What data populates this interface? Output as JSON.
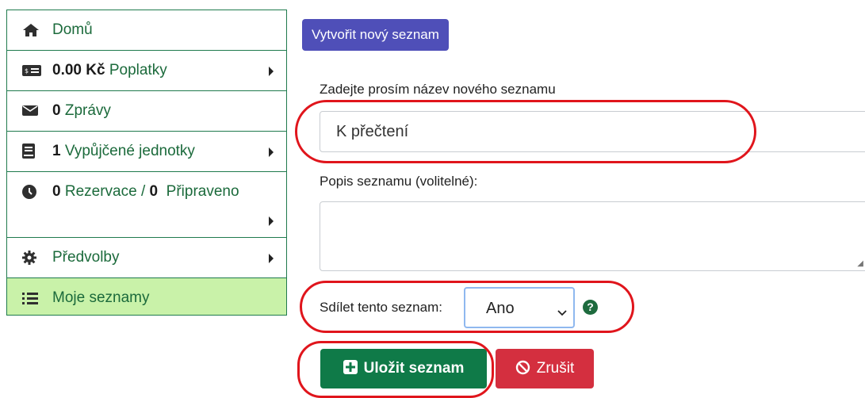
{
  "sidebar": {
    "items": [
      {
        "label": "Domů",
        "bold": "",
        "icon": "home-icon"
      },
      {
        "label": "Poplatky",
        "bold": "0.00 Kč",
        "icon": "money-icon"
      },
      {
        "label": "Zprávy",
        "bold": "0",
        "icon": "envelope-icon"
      },
      {
        "label": "Vypůjčené jednotky",
        "bold": "1",
        "icon": "book-icon"
      },
      {
        "label_before": "Rezervace /",
        "bold": "0",
        "bold2": "0",
        "label_after": "Připraveno",
        "icon": "clock-icon"
      },
      {
        "label": "Předvolby",
        "bold": "",
        "icon": "gear-icon"
      },
      {
        "label": "Moje seznamy",
        "bold": "",
        "icon": "list-icon"
      }
    ]
  },
  "main": {
    "create_button": "Vytvořit nový seznam",
    "name_label": "Zadejte prosím název nového seznamu",
    "name_value": "K přečtení",
    "description_label": "Popis seznamu (volitelné):",
    "share_label": "Sdílet tento seznam:",
    "share_value": "Ano",
    "help_icon_text": "?",
    "save_button": "Uložit seznam",
    "cancel_button": "Zrušit"
  },
  "colors": {
    "sidebar_text": "#1b6a3b",
    "active_bg": "#c9f2a9",
    "create_bg": "#4f4fb8",
    "save_bg": "#0f7a48",
    "cancel_bg": "#d42f3f",
    "annotation": "#e0151c"
  }
}
